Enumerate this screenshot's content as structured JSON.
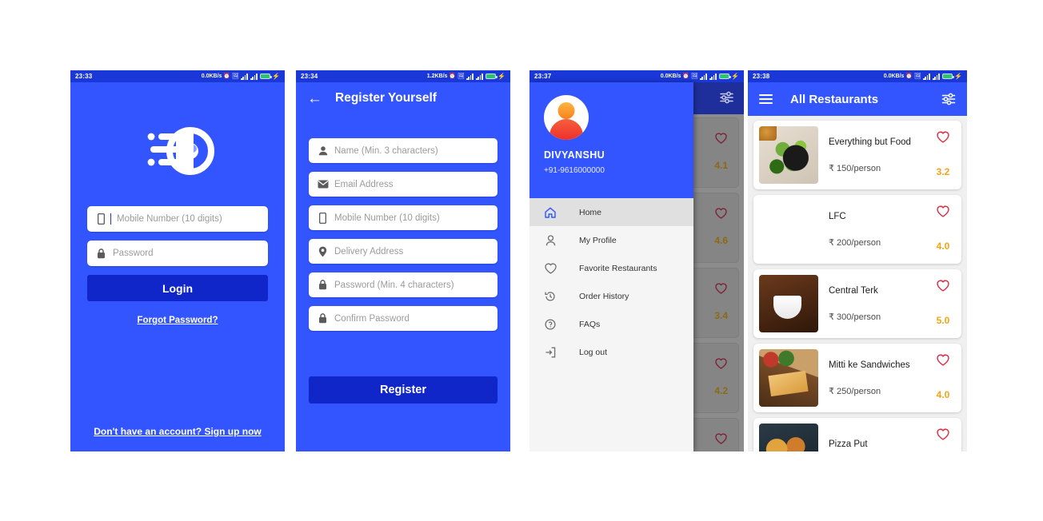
{
  "screens": {
    "login": {
      "status": {
        "time": "23:33",
        "speed": "0.0KB/s"
      },
      "logo_name": "delivery-speed-logo",
      "mobile_placeholder": "Mobile Number (10 digits)",
      "password_placeholder": "Password",
      "login_button": "Login",
      "forgot_link": "Forgot Password?",
      "signup_link": "Don't have an account? Sign up now"
    },
    "register": {
      "status": {
        "time": "23:34",
        "speed": "1.2KB/s"
      },
      "title": "Register Yourself",
      "fields": [
        {
          "placeholder": "Name (Min. 3 characters)",
          "icon": "person-icon"
        },
        {
          "placeholder": "Email Address",
          "icon": "envelope-icon"
        },
        {
          "placeholder": "Mobile Number (10 digits)",
          "icon": "phone-icon"
        },
        {
          "placeholder": "Delivery Address",
          "icon": "location-pin-icon"
        },
        {
          "placeholder": "Password (Min. 4 characters)",
          "icon": "lock-icon"
        },
        {
          "placeholder": "Confirm Password",
          "icon": "lock-icon"
        }
      ],
      "register_button": "Register"
    },
    "drawer": {
      "status": {
        "time": "23:37",
        "speed": "0.0KB/s"
      },
      "user_name": "DIVYANSHU",
      "user_phone": "+91-9616000000",
      "menu": [
        {
          "label": "Home",
          "icon": "home-icon",
          "active": true
        },
        {
          "label": "My Profile",
          "icon": "person-icon",
          "active": false
        },
        {
          "label": "Favorite Restaurants",
          "icon": "heart-icon",
          "active": false
        },
        {
          "label": "Order History",
          "icon": "history-icon",
          "active": false
        },
        {
          "label": "FAQs",
          "icon": "question-circle-icon",
          "active": false
        },
        {
          "label": "Log out",
          "icon": "logout-icon",
          "active": false
        }
      ],
      "dimmed_ratings": [
        "4.1",
        "4.6",
        "3.4",
        "4.2"
      ]
    },
    "restaurants": {
      "status": {
        "time": "23:38",
        "speed": "0.0KB/s"
      },
      "title": "All Restaurants",
      "menu_icon": "hamburger-menu-icon",
      "filter_icon": "tune-filter-icon",
      "items": [
        {
          "name": "Everything but Food",
          "price": "₹ 150/person",
          "rating": "3.2",
          "thumb": "t-salad"
        },
        {
          "name": "LFC",
          "price": "₹ 200/person",
          "rating": "4.0",
          "thumb": "t-fried"
        },
        {
          "name": "Central Terk",
          "price": "₹ 300/person",
          "rating": "5.0",
          "thumb": "t-coffee"
        },
        {
          "name": "Mitti ke Sandwiches",
          "price": "₹ 250/person",
          "rating": "4.0",
          "thumb": "t-sand"
        },
        {
          "name": "Pizza Put",
          "price": "",
          "rating": "",
          "thumb": "t-pizza"
        }
      ]
    }
  },
  "colors": {
    "primary_blue": "#3355ff",
    "dark_blue": "#1026c8",
    "statusbar_blue": "#1a37d8",
    "rating_orange": "#f5a314",
    "heart_red": "#d9344a"
  }
}
